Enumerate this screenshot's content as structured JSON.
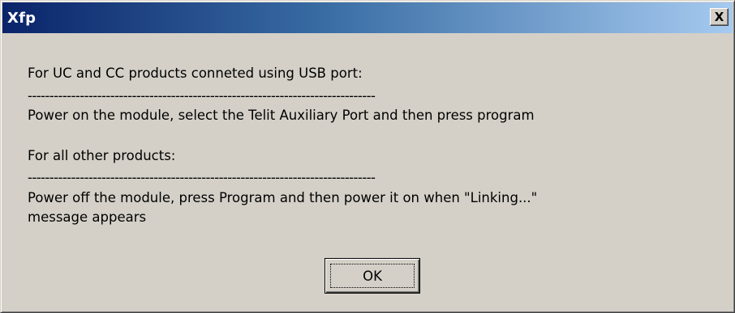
{
  "window": {
    "title": "Xfp",
    "close_glyph": "X"
  },
  "message": {
    "line1": "For UC and CC products conneted using USB port:",
    "separator1": "--------------------------------------------------------------------------------",
    "line2": "Power on the module, select the Telit Auxiliary Port and then press program",
    "line3": "For all other products:",
    "separator2": "--------------------------------------------------------------------------------",
    "line4": "Power off the module, press Program and then power it on when \"Linking...\"",
    "line5": "message appears"
  },
  "buttons": {
    "ok_label": "OK"
  }
}
